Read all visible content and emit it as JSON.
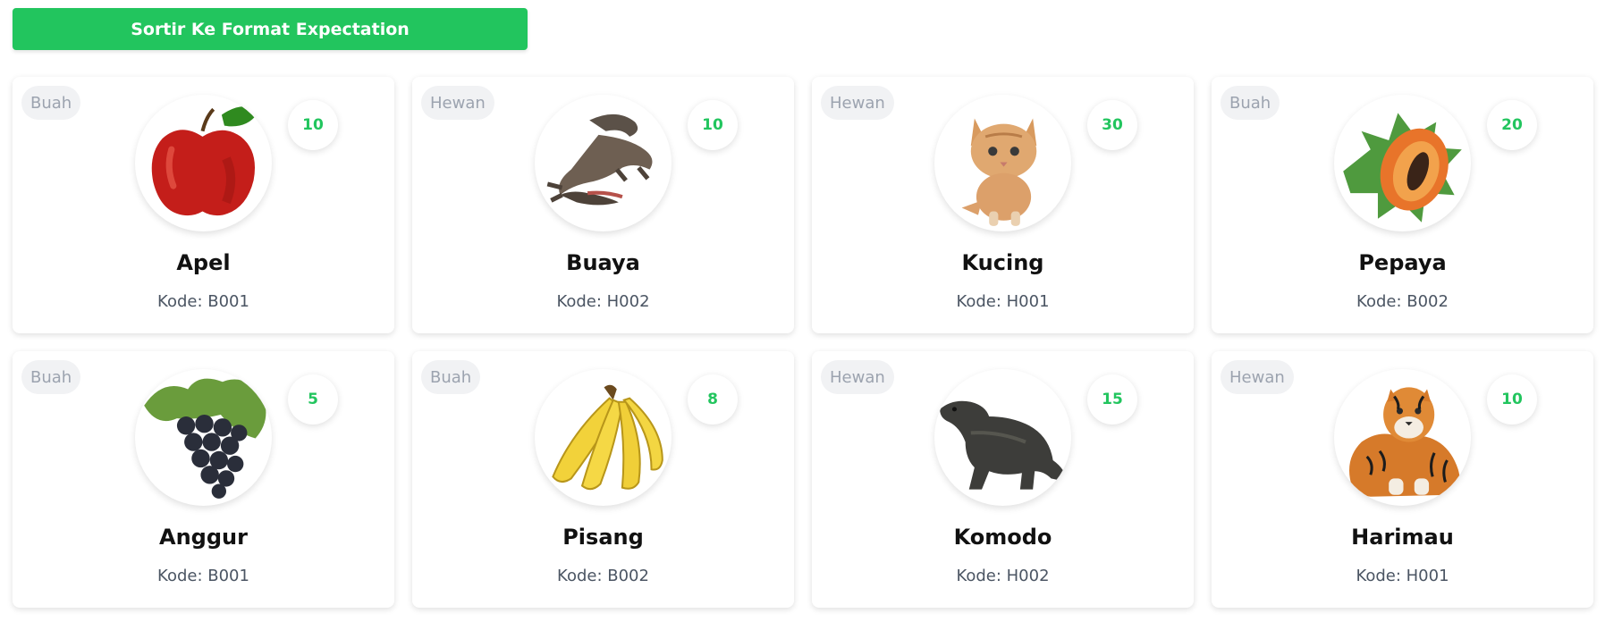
{
  "toolbar": {
    "sort_label": "Sortir Ke Format Expectation"
  },
  "colors": {
    "accent": "#22c55e",
    "badge_bg": "#f1f2f4",
    "badge_text": "#9ca3af"
  },
  "cards": [
    {
      "category": "Buah",
      "name": "Apel",
      "code": "Kode: B001",
      "count": "10",
      "icon": "apple-icon"
    },
    {
      "category": "Hewan",
      "name": "Buaya",
      "code": "Kode: H002",
      "count": "10",
      "icon": "crocodile-icon"
    },
    {
      "category": "Hewan",
      "name": "Kucing",
      "code": "Kode: H001",
      "count": "30",
      "icon": "cat-icon"
    },
    {
      "category": "Buah",
      "name": "Pepaya",
      "code": "Kode: B002",
      "count": "20",
      "icon": "papaya-icon"
    },
    {
      "category": "Buah",
      "name": "Anggur",
      "code": "Kode: B001",
      "count": "5",
      "icon": "grapes-icon"
    },
    {
      "category": "Buah",
      "name": "Pisang",
      "code": "Kode: B002",
      "count": "8",
      "icon": "banana-icon"
    },
    {
      "category": "Hewan",
      "name": "Komodo",
      "code": "Kode: H002",
      "count": "15",
      "icon": "komodo-icon"
    },
    {
      "category": "Hewan",
      "name": "Harimau",
      "code": "Kode: H001",
      "count": "10",
      "icon": "tiger-icon"
    }
  ]
}
